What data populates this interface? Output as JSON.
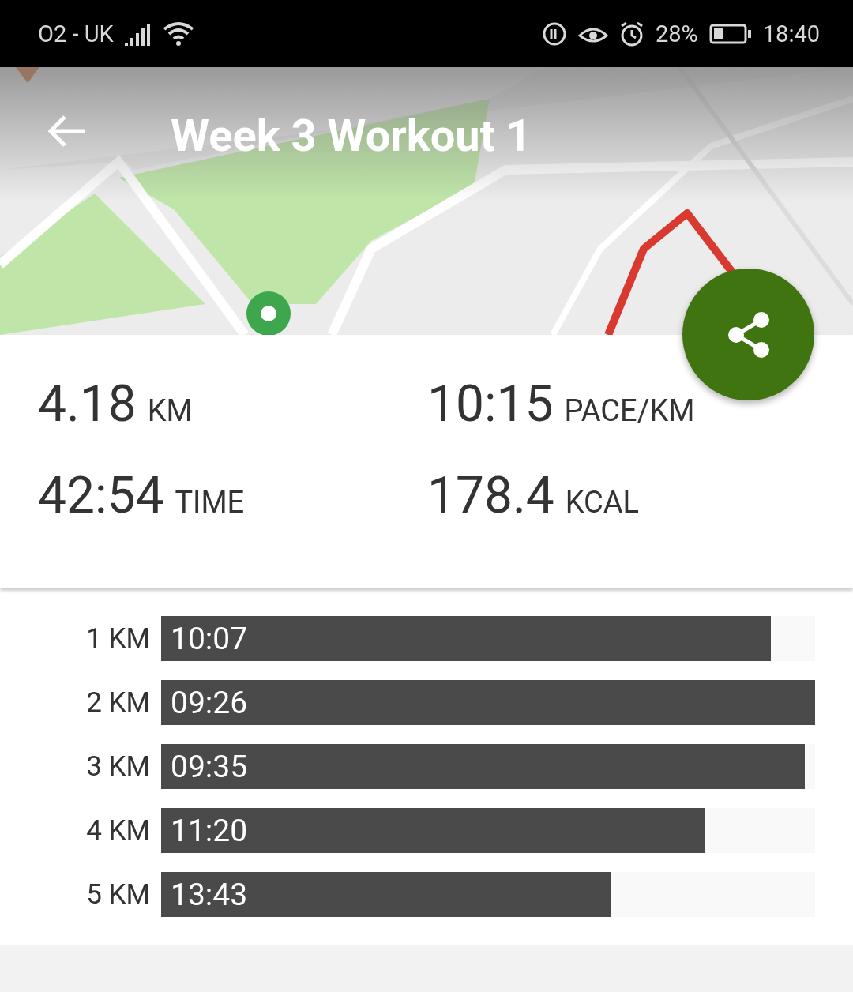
{
  "status_bar": {
    "carrier": "O2 - UK",
    "battery": "28%",
    "time": "18:40"
  },
  "header": {
    "title": "Week 3 Workout 1"
  },
  "stats": [
    {
      "value": "4.18",
      "unit": "KM"
    },
    {
      "value": "10:15",
      "unit": "PACE/KM"
    },
    {
      "value": "42:54",
      "unit": "TIME"
    },
    {
      "value": "178.4",
      "unit": "KCAL"
    }
  ],
  "splits": [
    {
      "label": "1 KM",
      "time": "10:07",
      "level": 0.932
    },
    {
      "label": "2 KM",
      "time": "09:26",
      "level": 1.0
    },
    {
      "label": "3 KM",
      "time": "09:35",
      "level": 0.984
    },
    {
      "label": "4 KM",
      "time": "11:20",
      "level": 0.832
    },
    {
      "label": "5 KM",
      "time": "13:43",
      "level": 0.687
    }
  ]
}
